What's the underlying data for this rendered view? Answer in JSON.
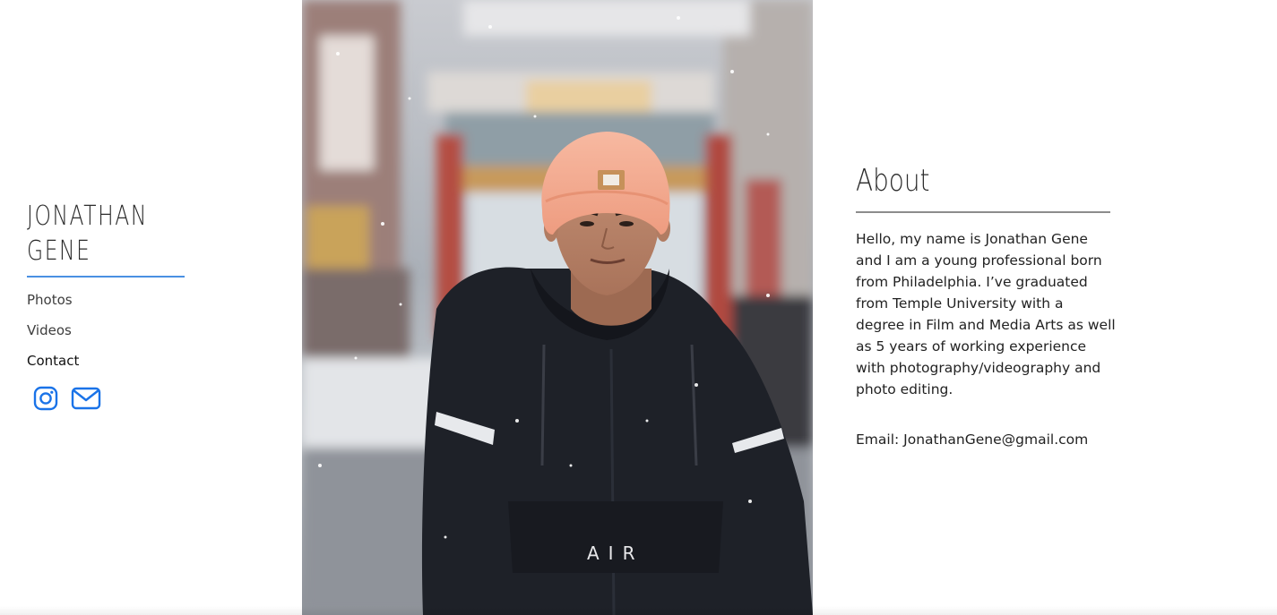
{
  "site": {
    "title_line1": "JONATHAN",
    "title_line2": "GENE"
  },
  "nav": {
    "items": [
      {
        "label": "Photos"
      },
      {
        "label": "Videos"
      },
      {
        "label": "Contact"
      }
    ],
    "active": "Contact"
  },
  "social": {
    "icons": [
      "instagram-icon",
      "mail-icon"
    ],
    "color": "#1a73e8"
  },
  "photo": {
    "jacket_text": "AIR"
  },
  "about": {
    "title": "About",
    "body": "Hello, my name is Jonathan Gene and I am a young professional born from Philadelphia. I’ve graduated from Temple University with a degree in Film and Media Arts as well as 5 years of working experience with photography/videography and photo editing.",
    "email_line": "Email: JonathanGene@gmail.com"
  },
  "colors": {
    "accent": "#4a90e2",
    "rule": "#8c8c8c",
    "text": "#222222"
  }
}
